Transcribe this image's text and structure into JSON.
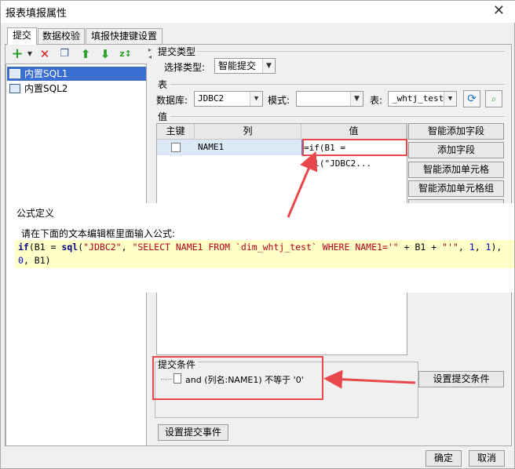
{
  "window": {
    "title": "报表填报属性",
    "close": "✕"
  },
  "tabs": [
    "提交",
    "数据校验",
    "填报快捷键设置"
  ],
  "tree": {
    "items": [
      "内置SQL1",
      "内置SQL2"
    ]
  },
  "submit_type": {
    "group": "提交类型",
    "label": "选择类型:",
    "value": "智能提交"
  },
  "table_group": {
    "group": "表",
    "db_label": "数据库:",
    "db_value": "JDBC2",
    "schema_label": "模式:",
    "schema_value": "",
    "table_label": "表:",
    "table_value": "_whtj_test"
  },
  "values_group": {
    "group": "值",
    "headers": [
      "主键",
      "列",
      "值"
    ],
    "row": {
      "column": "NAME1",
      "value": "=if(B1 = sql(\"JDBC2..."
    }
  },
  "side_buttons": [
    "智能添加字段",
    "添加字段",
    "智能添加单元格",
    "智能添加单元格组"
  ],
  "formula": {
    "title": "公式定义",
    "prompt": "请在下面的文本编辑框里面输入公式:",
    "line1_parts": [
      "if",
      "(B1 = ",
      "sql",
      "(",
      "\"JDBC2\"",
      ", ",
      "\"SELECT NAME1 FROM `dim_whtj_test` WHERE NAME1='\"",
      " + B1 + ",
      "\"'\"",
      ", ",
      "1",
      ", ",
      "1",
      "),"
    ],
    "line2_parts": [
      "0",
      ", B1)"
    ]
  },
  "condition": {
    "group": "提交条件",
    "text": "and (列名:NAME1) 不等于 '0'",
    "button": "设置提交条件"
  },
  "event_button": "设置提交事件",
  "ok": "确定",
  "cancel": "取消",
  "colors": {
    "selection": "#3a6fd0",
    "annotation": "#e8474b",
    "code_bg": "#ffffc8"
  }
}
